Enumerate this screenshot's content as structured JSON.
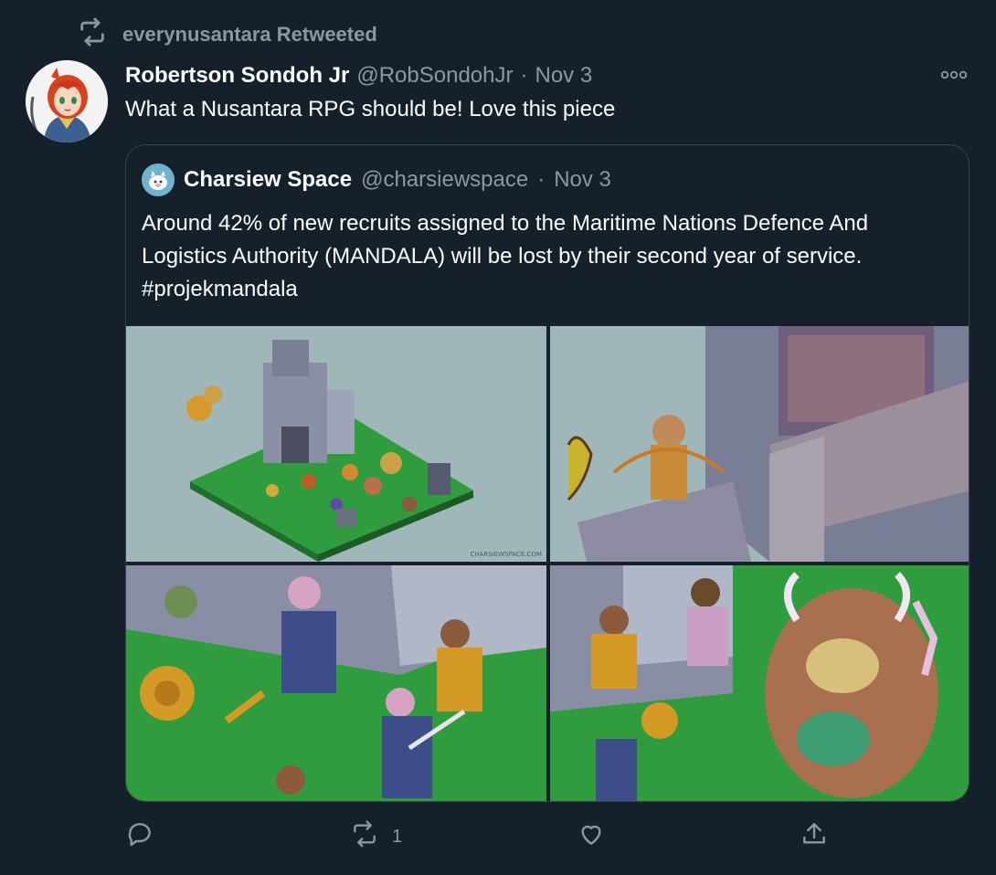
{
  "retweet_context": {
    "label": "everynusantara Retweeted",
    "icon": "retweet-icon"
  },
  "tweet": {
    "author_name": "Robertson Sondoh Jr",
    "author_handle": "@RobSondohJr",
    "separator": "·",
    "date": "Nov 3",
    "text": "What a Nusantara RPG should be! Love this piece",
    "more_icon": "more-horizontal-icon"
  },
  "quoted_tweet": {
    "author_name": "Charsiew Space",
    "author_handle": "@charsiewspace",
    "separator": "·",
    "date": "Nov 3",
    "text": "Around 42% of new recruits assigned to the Maritime Nations Defence And Logistics Authority (MANDALA) will be lost by their second year of service. #projekmandala",
    "media": [
      {
        "name": "media-image-1",
        "watermark": "CHARSIEWSPACE.COM"
      },
      {
        "name": "media-image-2"
      },
      {
        "name": "media-image-3"
      },
      {
        "name": "media-image-4"
      }
    ]
  },
  "actions": {
    "reply_count": "",
    "retweet_count": "1",
    "like_count": "",
    "icons": [
      "reply-icon",
      "retweet-icon",
      "like-icon",
      "share-icon"
    ]
  },
  "colors": {
    "background": "#15202b",
    "secondary_text": "#8899a6",
    "border": "#38444d",
    "primary_text": "#ffffff"
  }
}
